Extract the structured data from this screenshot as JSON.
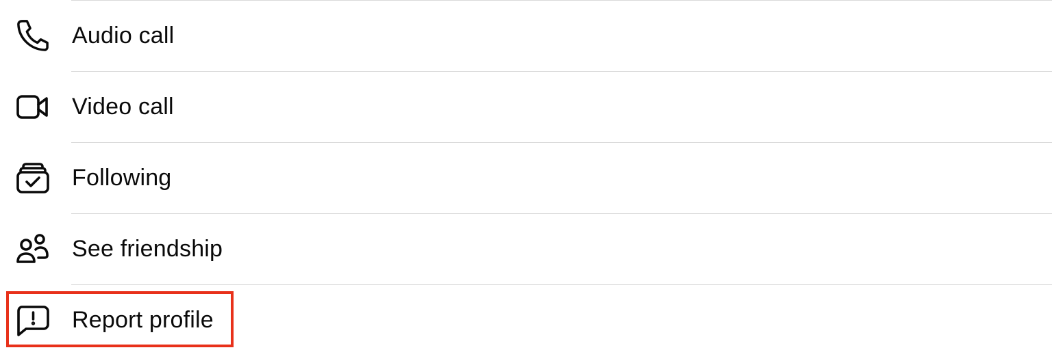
{
  "menu": {
    "items": [
      {
        "label": "Audio call",
        "icon": "phone-icon"
      },
      {
        "label": "Video call",
        "icon": "video-camera-icon"
      },
      {
        "label": "Following",
        "icon": "following-inbox-check-icon"
      },
      {
        "label": "See friendship",
        "icon": "people-friendship-icon"
      },
      {
        "label": "Report profile",
        "icon": "report-speech-bubble-icon"
      }
    ]
  },
  "colors": {
    "text": "#0a0a0a",
    "divider": "#d9d9d9",
    "highlight": "#e8311a",
    "background": "#ffffff"
  },
  "highlighted_item": "Report profile"
}
